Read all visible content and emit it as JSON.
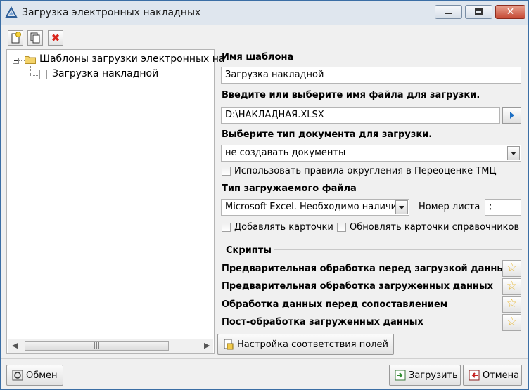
{
  "window": {
    "title": "Загрузка электронных накладных",
    "minimize_glyph": "",
    "maximize_glyph": "",
    "close_glyph": "✕"
  },
  "toolbar": {
    "add_icon": "new-document-icon",
    "copy_icon": "copy-icon",
    "delete_icon": "delete-icon",
    "delete_glyph": "✖",
    "delete_color": "#d9261c"
  },
  "tree": {
    "root_label": "Шаблоны загрузки электронных на",
    "child_label": "Загрузка накладной",
    "scroll_thumb": "|||",
    "scroll_left": "◀",
    "scroll_right": "▶"
  },
  "form": {
    "template_name_label": "Имя шаблона",
    "template_name_value": "Загрузка накладной",
    "file_label": "Введите или выберите имя файла для загрузки.",
    "file_value": "D:\\НАКЛАДНАЯ.XLSX",
    "doc_type_label": "Выберите тип документа для загрузки.",
    "doc_type_value": "не создавать документы",
    "rounding_label": "Использовать правила округления в Переоценке ТМЦ",
    "file_type_label": "Тип загружаемого файла",
    "file_type_value": "Microsoft Excel. Необходимо наличие I",
    "sheet_label": "Номер листа",
    "sheet_value": ";",
    "add_cards_label": "Добавлять карточки",
    "update_cards_label": "Обновлять карточки справочников"
  },
  "scripts": {
    "group_label": "Скрипты",
    "items": [
      {
        "label": "Предварительная обработка  перед загрузкой данных"
      },
      {
        "label": "Предварительная обработка загруженных данных"
      },
      {
        "label": "Обработка данных перед сопоставлением"
      },
      {
        "label": "Пост-обработка загруженных данных"
      }
    ],
    "star_glyph": "☆",
    "mapping_button_label": "Настройка соответствия полей"
  },
  "footer": {
    "exchange_label": "Обмен",
    "load_label": "Загрузить",
    "cancel_label": "Отмена"
  },
  "colors": {
    "title_bar": "#dfe6ee",
    "accent": "#1d6fc4",
    "close_button": "#c64a35"
  }
}
